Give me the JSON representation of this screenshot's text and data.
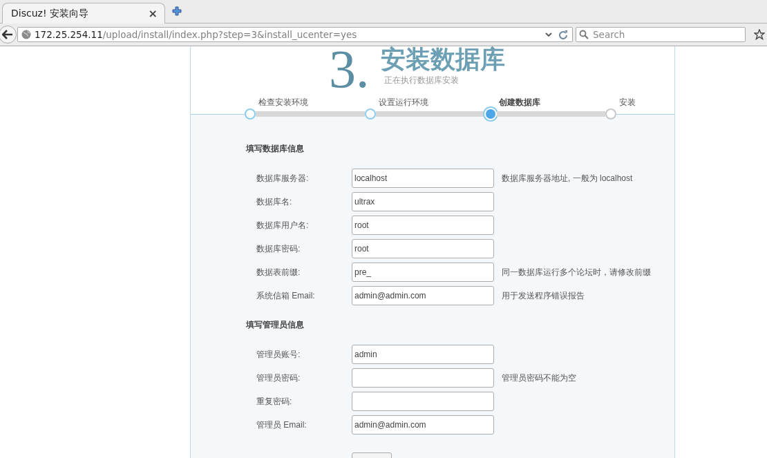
{
  "browser": {
    "tab": {
      "title": "Discuz! 安装向导",
      "close": "×"
    },
    "address": {
      "host": "172.25.254.11",
      "path": "/upload/install/index.php?step=3&install_ucenter=yes"
    },
    "search": {
      "placeholder": "Search"
    }
  },
  "header": {
    "number": "3.",
    "title": "安装数据库",
    "subtitle": "正在执行数据库安装"
  },
  "steps": [
    {
      "label": "检查安装环境",
      "done": true,
      "selected": false
    },
    {
      "label": "设置运行环境",
      "done": true,
      "selected": false
    },
    {
      "label": "创建数据库",
      "done": false,
      "selected": true
    },
    {
      "label": "安装",
      "done": false,
      "selected": false
    }
  ],
  "sections": [
    {
      "title": "填写数据库信息",
      "rows": [
        {
          "label": "数据库服务器:",
          "value": "localhost",
          "note": "数据库服务器地址, 一般为 localhost"
        },
        {
          "label": "数据库名:",
          "value": "ultrax"
        },
        {
          "label": "数据库用户名:",
          "value": "root"
        },
        {
          "label": "数据库密码:",
          "value": "root"
        },
        {
          "label": "数据表前缀:",
          "value": "pre_",
          "note": "同一数据库运行多个论坛时，请修改前缀"
        },
        {
          "label": "系统信箱 Email:",
          "value": "admin@admin.com",
          "note": "用于发送程序错误报告"
        }
      ]
    },
    {
      "title": "填写管理员信息",
      "rows": [
        {
          "label": "管理员账号:",
          "value": "admin"
        },
        {
          "label": "管理员密码:",
          "note": "管理员密码不能为空"
        },
        {
          "label": "重复密码:"
        },
        {
          "label": "管理员 Email:",
          "value": "admin@admin.com"
        }
      ]
    }
  ]
}
